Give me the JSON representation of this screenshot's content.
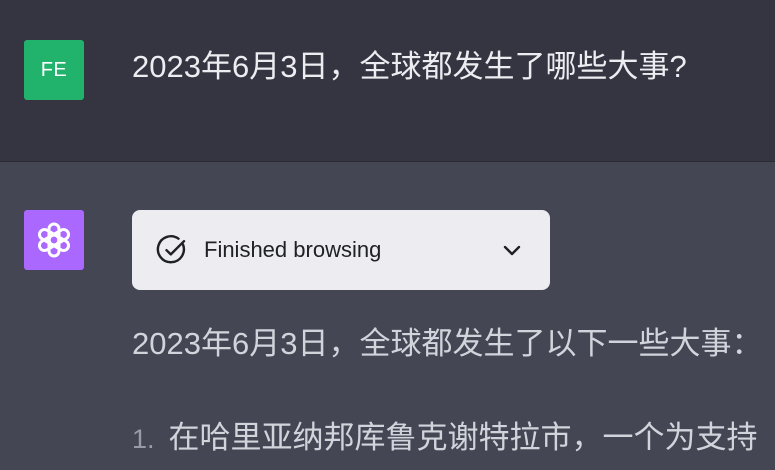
{
  "user": {
    "avatar_initials": "FE",
    "avatar_color": "#21b26b",
    "message": "2023年6月3日，全球都发生了哪些大事?"
  },
  "assistant": {
    "avatar_icon": "openai-logo-icon",
    "avatar_color": "#ab68ff",
    "browse": {
      "status_icon": "check-circle-icon",
      "label": "Finished browsing",
      "toggle_icon": "chevron-down-icon"
    },
    "intro": "2023年6月3日，全球都发生了以下一些大事：",
    "items": [
      {
        "number": "1.",
        "text": "在哈里亚纳邦库鲁克谢特拉市，一个为支持"
      }
    ]
  },
  "colors": {
    "user_row_bg": "#343541",
    "assistant_row_bg": "#444654",
    "card_bg": "#ececf1"
  }
}
